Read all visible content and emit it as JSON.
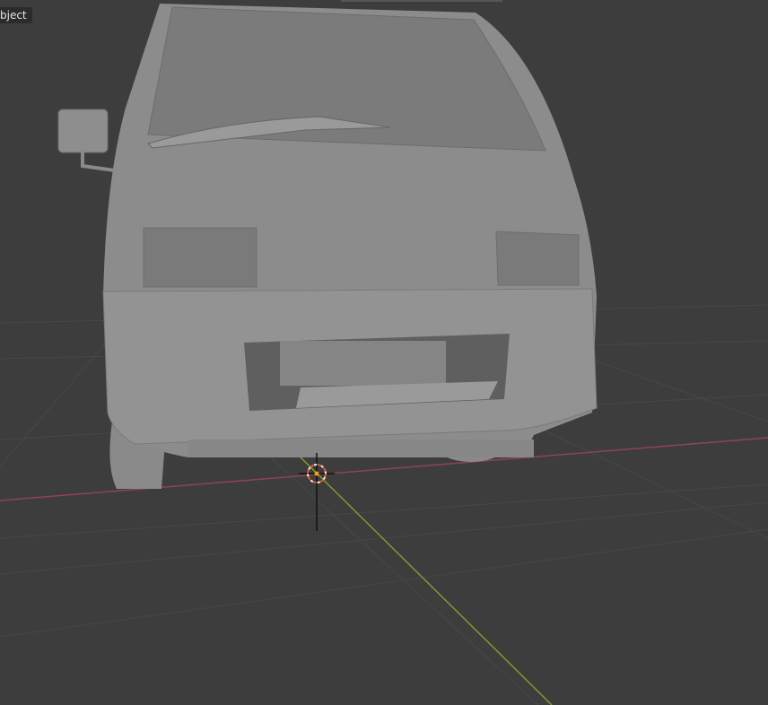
{
  "viewport": {
    "mode_label": "Object",
    "mode_label_visible": "bject",
    "colors": {
      "background": "#3d3d3d",
      "grid": "#4a4a4a",
      "x_axis": "#9a4a55",
      "y_axis": "#7a9a35",
      "mesh": "#8f8f8f"
    }
  },
  "scene": {
    "object": "van-mesh",
    "cursor": "3d-cursor"
  }
}
